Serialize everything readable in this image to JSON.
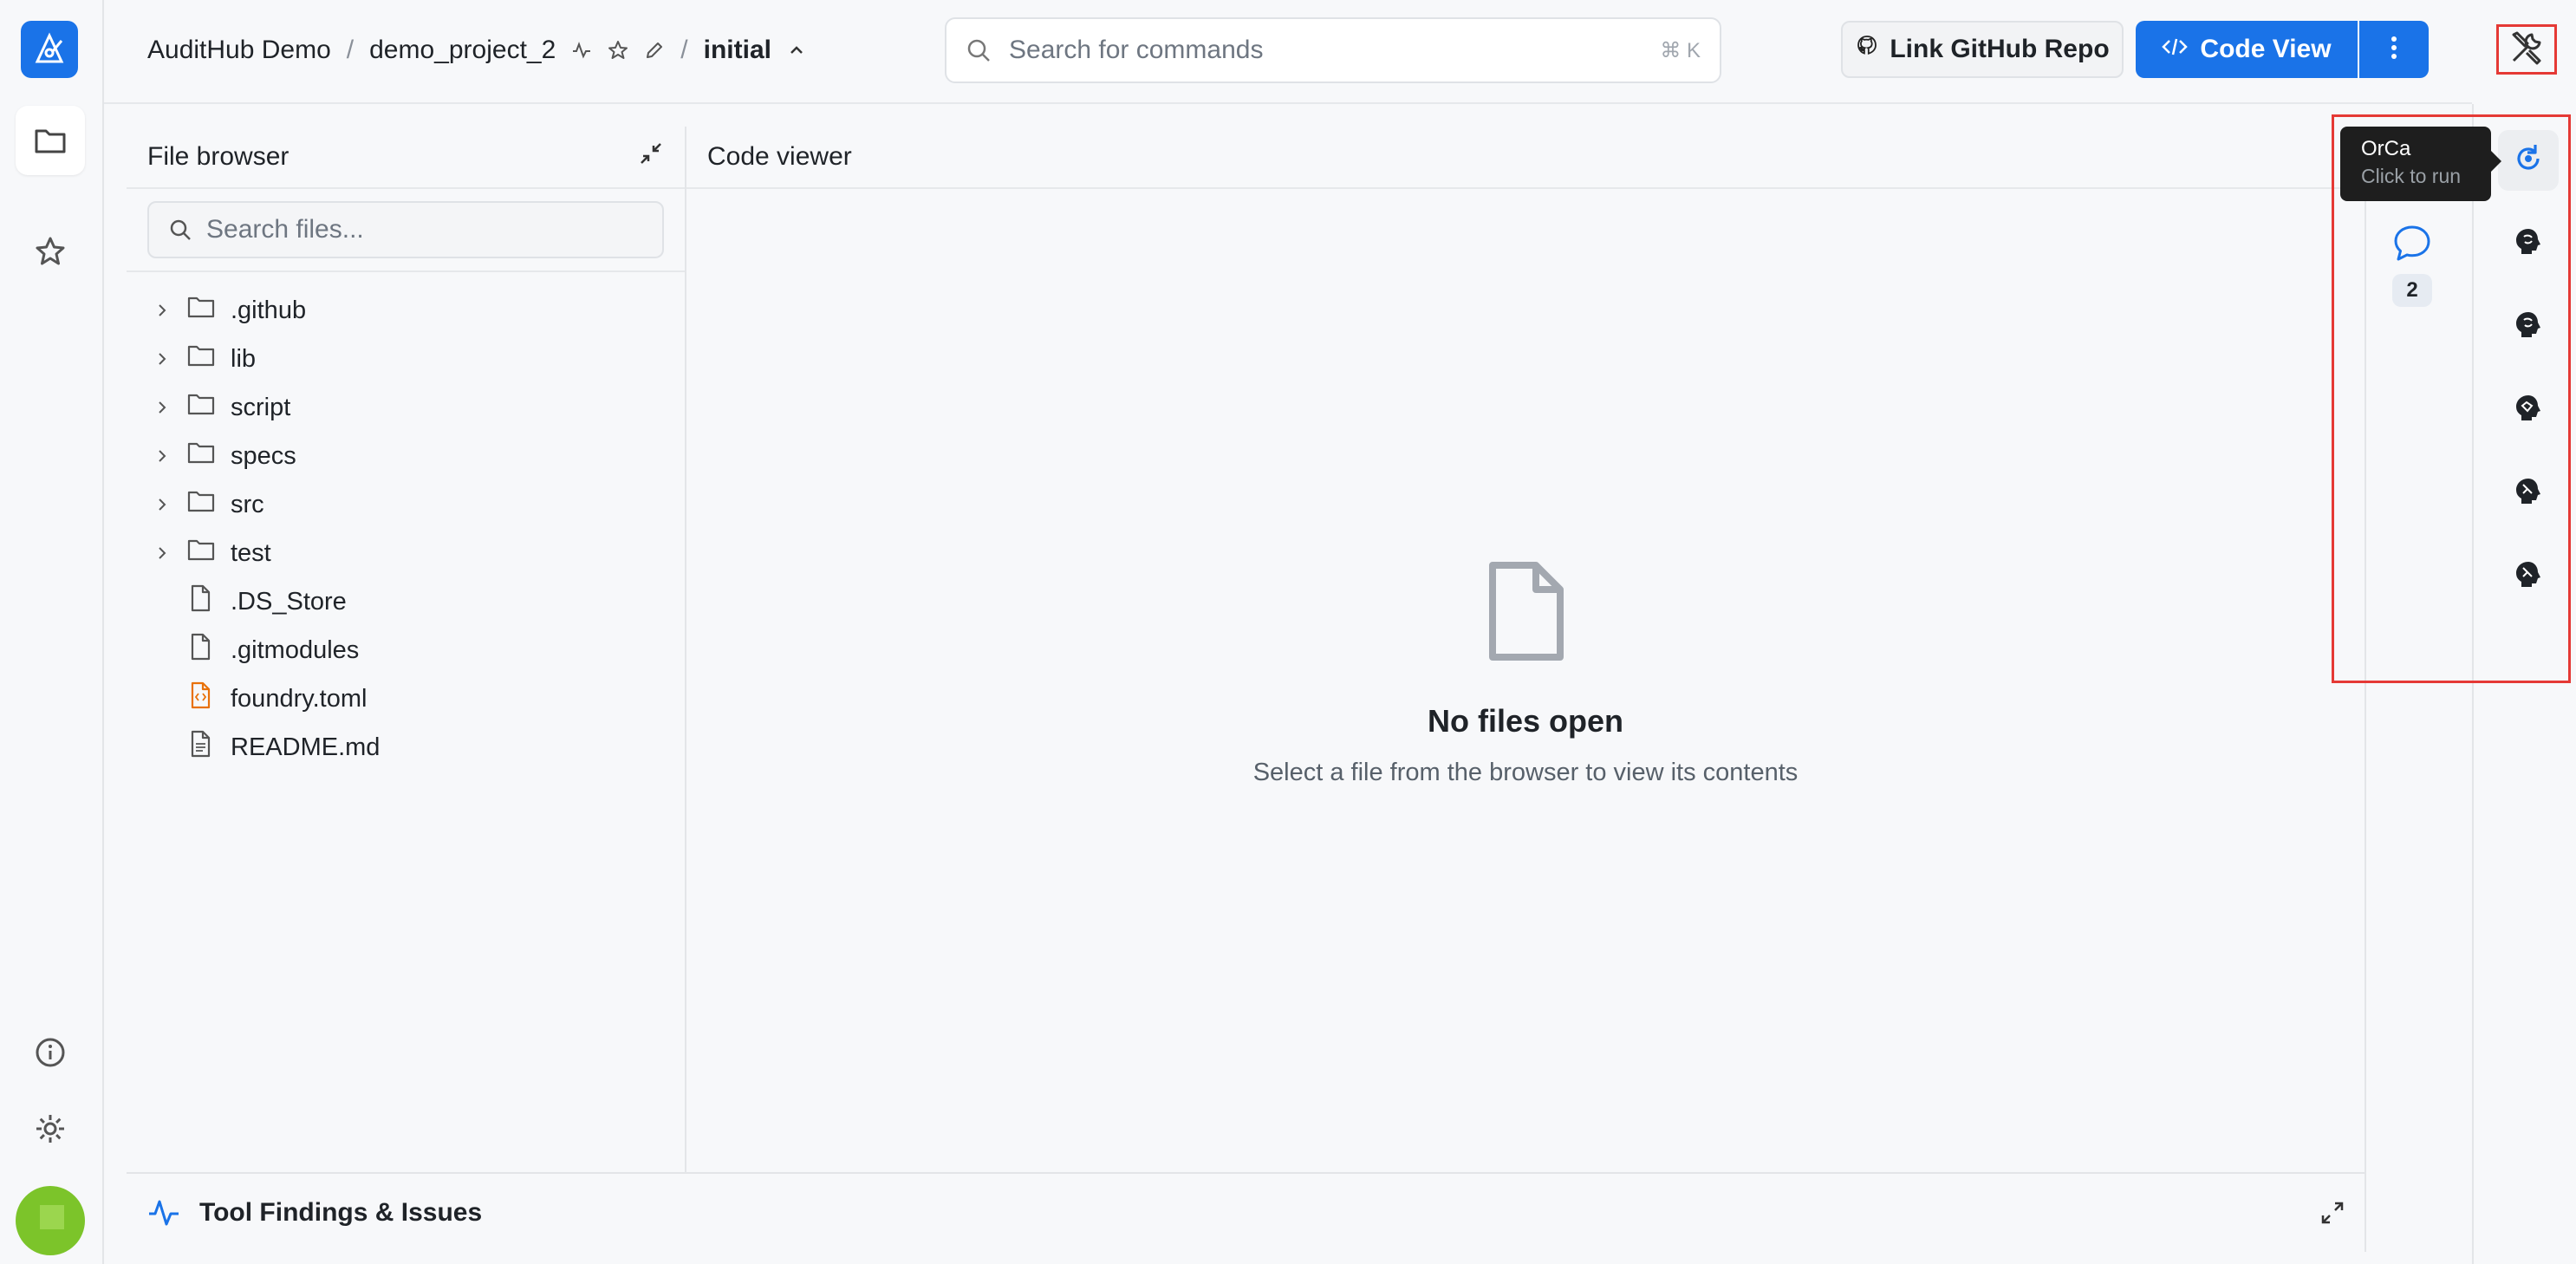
{
  "colors": {
    "accent": "#1a73e8",
    "highlight": "#e53935",
    "file_toml": "#e8710a"
  },
  "breadcrumb": {
    "project_group": "AuditHub Demo",
    "separator": "/",
    "project": "demo_project_2",
    "version": "initial"
  },
  "search": {
    "placeholder": "Search for commands",
    "shortcut": "⌘ K"
  },
  "toolbar": {
    "github_label": "Link GitHub Repo",
    "code_view_label": "Code View"
  },
  "file_browser": {
    "title": "File browser",
    "search_placeholder": "Search files...",
    "items": [
      {
        "name": ".github",
        "type": "folder"
      },
      {
        "name": "lib",
        "type": "folder"
      },
      {
        "name": "script",
        "type": "folder"
      },
      {
        "name": "specs",
        "type": "folder"
      },
      {
        "name": "src",
        "type": "folder"
      },
      {
        "name": "test",
        "type": "folder"
      },
      {
        "name": ".DS_Store",
        "type": "file"
      },
      {
        "name": ".gitmodules",
        "type": "file"
      },
      {
        "name": "foundry.toml",
        "type": "toml"
      },
      {
        "name": "README.md",
        "type": "text"
      }
    ]
  },
  "code_viewer": {
    "title": "Code viewer",
    "empty_title": "No files open",
    "empty_subtitle": "Select a file from the browser to view its contents"
  },
  "findings": {
    "label": "Tool Findings & Issues"
  },
  "comments": {
    "count": "2"
  },
  "tooltip": {
    "title": "OrCa",
    "subtitle": "Click to run"
  },
  "tools": [
    "refresh-icon",
    "brain-shield-icon",
    "brain-shield-icon",
    "shield-check-icon",
    "shield-scan-icon",
    "shield-scan-icon"
  ]
}
